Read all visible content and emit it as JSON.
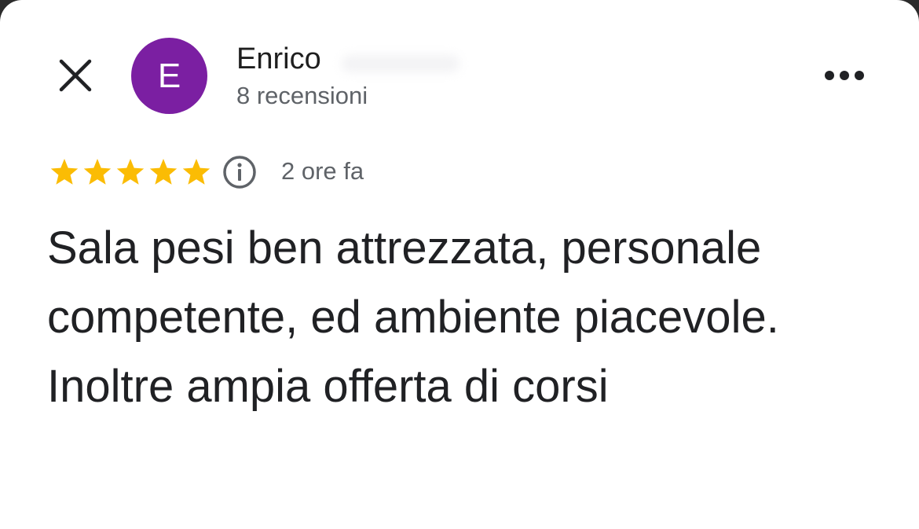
{
  "header": {
    "close_icon": "close-icon",
    "more_icon": "more-horiz-icon"
  },
  "reviewer": {
    "avatar_letter": "E",
    "avatar_color": "#7b1fa2",
    "name": "Enrico",
    "reviews_count": "8 recensioni"
  },
  "review": {
    "rating": 5,
    "max_rating": 5,
    "star_color": "#fbbc04",
    "info_icon": "info-icon",
    "time_ago": "2 ore fa",
    "text": "Sala pesi ben attrezzata, personale competente, ed ambiente piacevole. Inoltre ampia offerta di corsi"
  }
}
